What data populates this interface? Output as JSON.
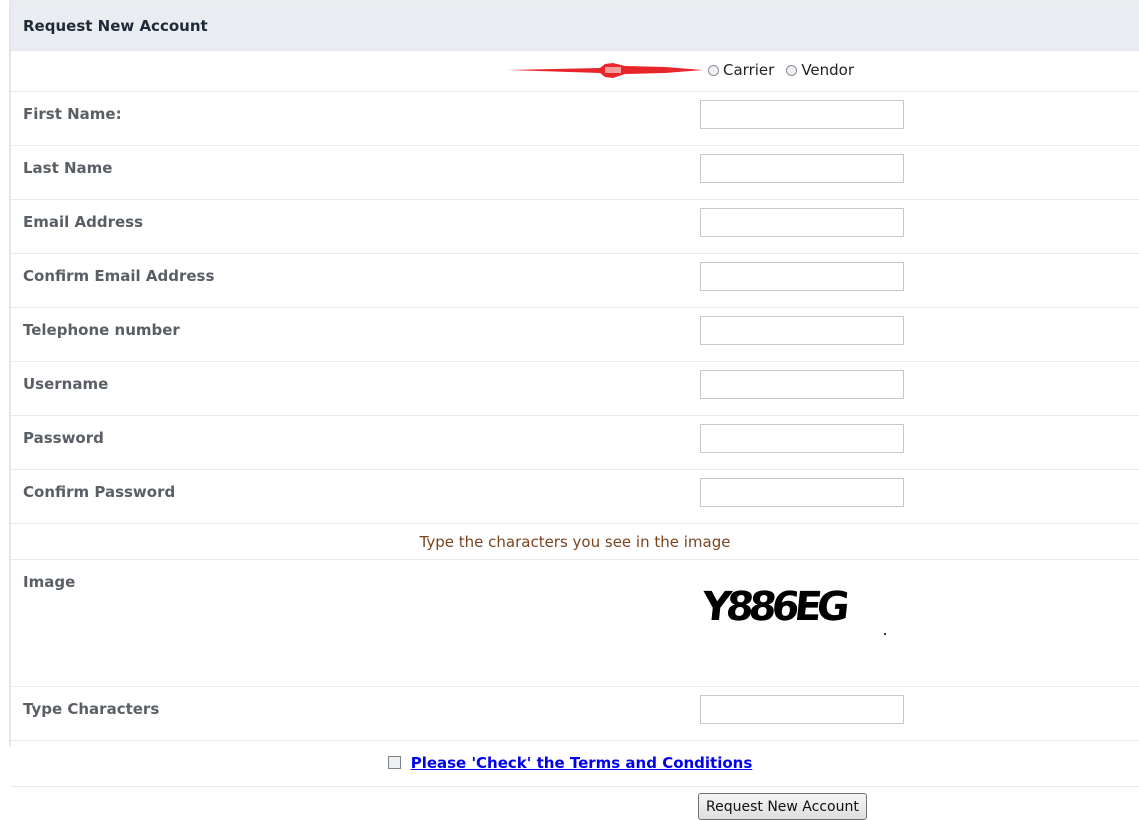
{
  "form": {
    "title": "Request New Account",
    "account_type": {
      "options": [
        "Carrier",
        "Vendor"
      ]
    },
    "fields": [
      {
        "label": "First Name:",
        "value": ""
      },
      {
        "label": "Last Name",
        "value": ""
      },
      {
        "label": "Email Address",
        "value": ""
      },
      {
        "label": "Confirm Email Address",
        "value": ""
      },
      {
        "label": "Telephone number",
        "value": ""
      },
      {
        "label": "Username",
        "value": ""
      },
      {
        "label": "Password",
        "value": ""
      },
      {
        "label": "Confirm Password",
        "value": ""
      }
    ],
    "captcha": {
      "prompt": "Type the characters you see in the image",
      "image_label": "Image",
      "image_text": "Y886EG",
      "input_label": "Type Characters"
    },
    "terms_link": "Please 'Check' the Terms and Conditions",
    "submit_label": "Request New Account"
  },
  "colors": {
    "header_bg": "#e9edf1",
    "link": "#0000ee",
    "prompt": "#7a4420",
    "annotation_arrow": "#e8252b"
  }
}
